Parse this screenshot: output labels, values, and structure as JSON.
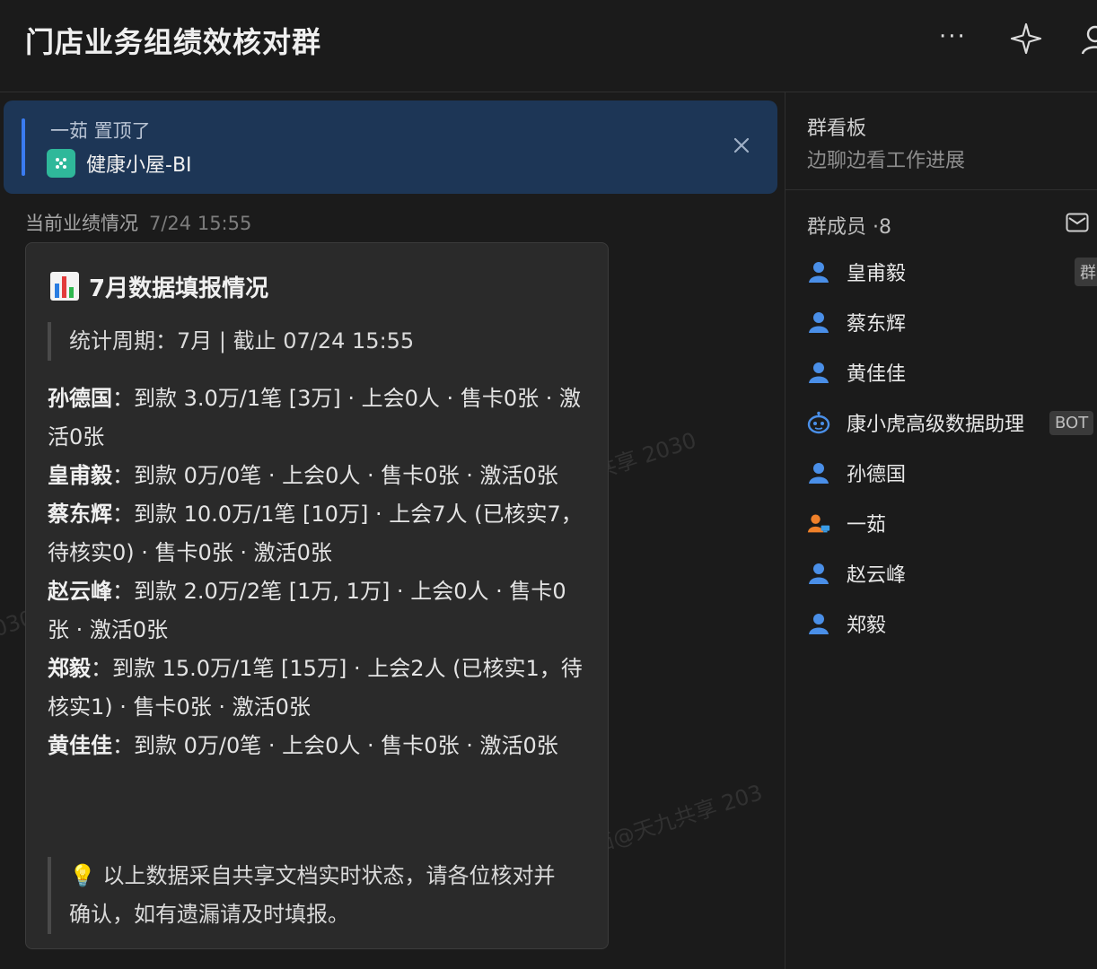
{
  "header": {
    "title": "门店业务组绩效核对群",
    "more_glyph": "···"
  },
  "pinned": {
    "pinned_by": "一茹 置顶了",
    "doc_name": "健康小屋-BI"
  },
  "message": {
    "sender": "当前业绩情况",
    "time": "7/24 15:55",
    "card": {
      "title": "7月数据填报情况",
      "period": "统计周期：7月 | 截止 07/24 15:55",
      "entries": [
        {
          "name": "孙德国",
          "detail": "：到款 3.0万/1笔 [3万] · 上会0人 · 售卡0张 · 激活0张"
        },
        {
          "name": "皇甫毅",
          "detail": "：到款 0万/0笔 · 上会0人 · 售卡0张 · 激活0张"
        },
        {
          "name": "蔡东辉",
          "detail": "：到款 10.0万/1笔 [10万] · 上会7人 (已核实7，待核实0) · 售卡0张 · 激活0张"
        },
        {
          "name": "赵云峰",
          "detail": "：到款 2.0万/2笔 [1万, 1万] · 上会0人 · 售卡0张 · 激活0张"
        },
        {
          "name": "郑毅",
          "detail": "：到款 15.0万/1笔 [15万] · 上会2人 (已核实1，待核实1) · 售卡0张 · 激活0张"
        },
        {
          "name": "黄佳佳",
          "detail": "：到款 0万/0笔 · 上会0人 · 售卡0张 · 激活0张"
        }
      ],
      "note": "💡 以上数据采自共享文档实时状态，请各位核对并确认，如有遗漏请及时填报。"
    }
  },
  "watermarks": [
    "共享 2030",
    "茹@天九共享 203",
    "030"
  ],
  "sidebar": {
    "board_title": "群看板",
    "board_subtitle": "边聊边看工作进展",
    "members_title": "群成员 ·8",
    "members": [
      {
        "name": "皇甫毅",
        "avatar": "person-icon",
        "badge": "群"
      },
      {
        "name": "蔡东辉",
        "avatar": "person-icon",
        "badge": ""
      },
      {
        "name": "黄佳佳",
        "avatar": "person-icon",
        "badge": ""
      },
      {
        "name": "康小虎高级数据助理",
        "avatar": "bot-icon",
        "badge": "BOT"
      },
      {
        "name": "孙德国",
        "avatar": "person-icon",
        "badge": ""
      },
      {
        "name": "一茹",
        "avatar": "person-admin-icon",
        "badge": ""
      },
      {
        "name": "赵云峰",
        "avatar": "person-icon",
        "badge": ""
      },
      {
        "name": "郑毅",
        "avatar": "person-icon",
        "badge": ""
      }
    ]
  },
  "colors": {
    "background": "#1b1b1b",
    "pin_background": "#1d3656",
    "accent_blue": "#3a7bf0",
    "person_icon": "#4a8fe8",
    "admin_icon": "#f0812a",
    "doc_icon": "#2fb89a"
  }
}
